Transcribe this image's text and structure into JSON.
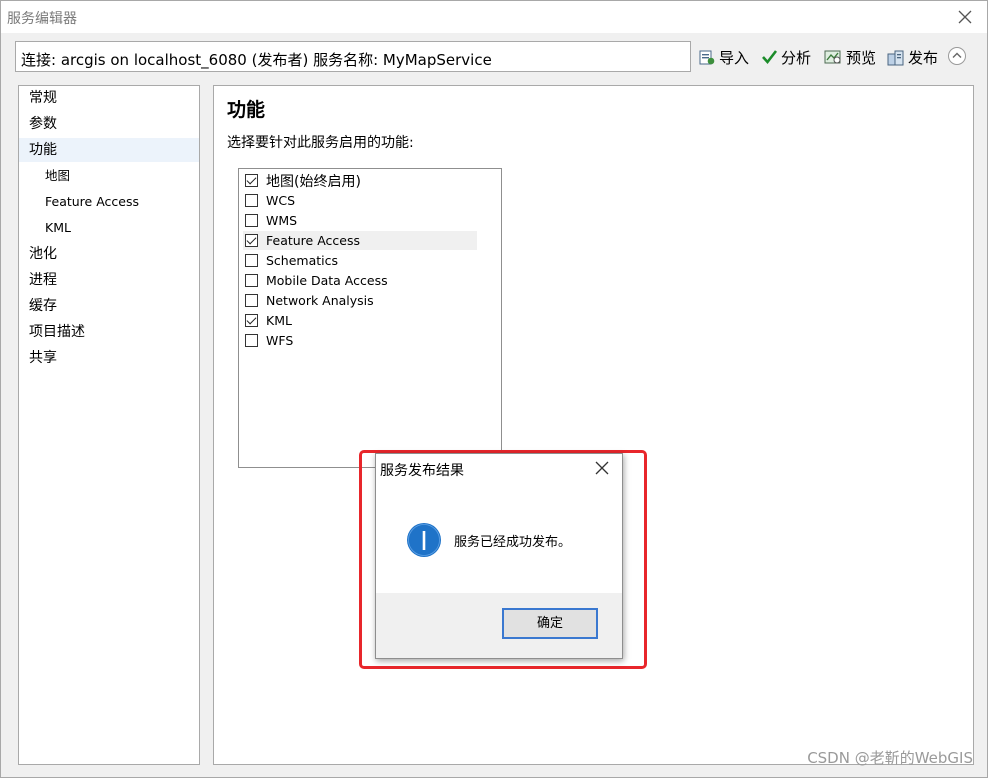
{
  "window": {
    "title": "服务编辑器"
  },
  "connection": {
    "text": "连接: arcgis on localhost_6080 (发布者)   服务名称: MyMapService"
  },
  "toolbar": {
    "import_label": "导入",
    "analyze_label": "分析",
    "preview_label": "预览",
    "publish_label": "发布"
  },
  "sidebar": {
    "items": [
      {
        "label": "常规"
      },
      {
        "label": "参数"
      },
      {
        "label": "功能"
      },
      {
        "label": "地图"
      },
      {
        "label": "Feature Access"
      },
      {
        "label": "KML"
      },
      {
        "label": "池化"
      },
      {
        "label": "进程"
      },
      {
        "label": "缓存"
      },
      {
        "label": "项目描述"
      },
      {
        "label": "共享"
      }
    ],
    "selected": "功能"
  },
  "main": {
    "heading": "功能",
    "prompt": "选择要针对此服务启用的功能:",
    "capabilities": [
      {
        "label": "地图(始终启用)",
        "checked": true
      },
      {
        "label": "WCS",
        "checked": false
      },
      {
        "label": "WMS",
        "checked": false
      },
      {
        "label": "Feature Access",
        "checked": true
      },
      {
        "label": "Schematics",
        "checked": false
      },
      {
        "label": "Mobile Data Access",
        "checked": false
      },
      {
        "label": "Network Analysis",
        "checked": false
      },
      {
        "label": "KML",
        "checked": true
      },
      {
        "label": "WFS",
        "checked": false
      }
    ]
  },
  "dialog": {
    "title": "服务发布结果",
    "message": "服务已经成功发布。",
    "ok_label": "确定"
  },
  "watermark": "CSDN @老靳的WebGIS",
  "colors": {
    "highlight_border": "#e8262b",
    "info_icon": "#1f73c8",
    "ok_border": "#3a78d0"
  }
}
